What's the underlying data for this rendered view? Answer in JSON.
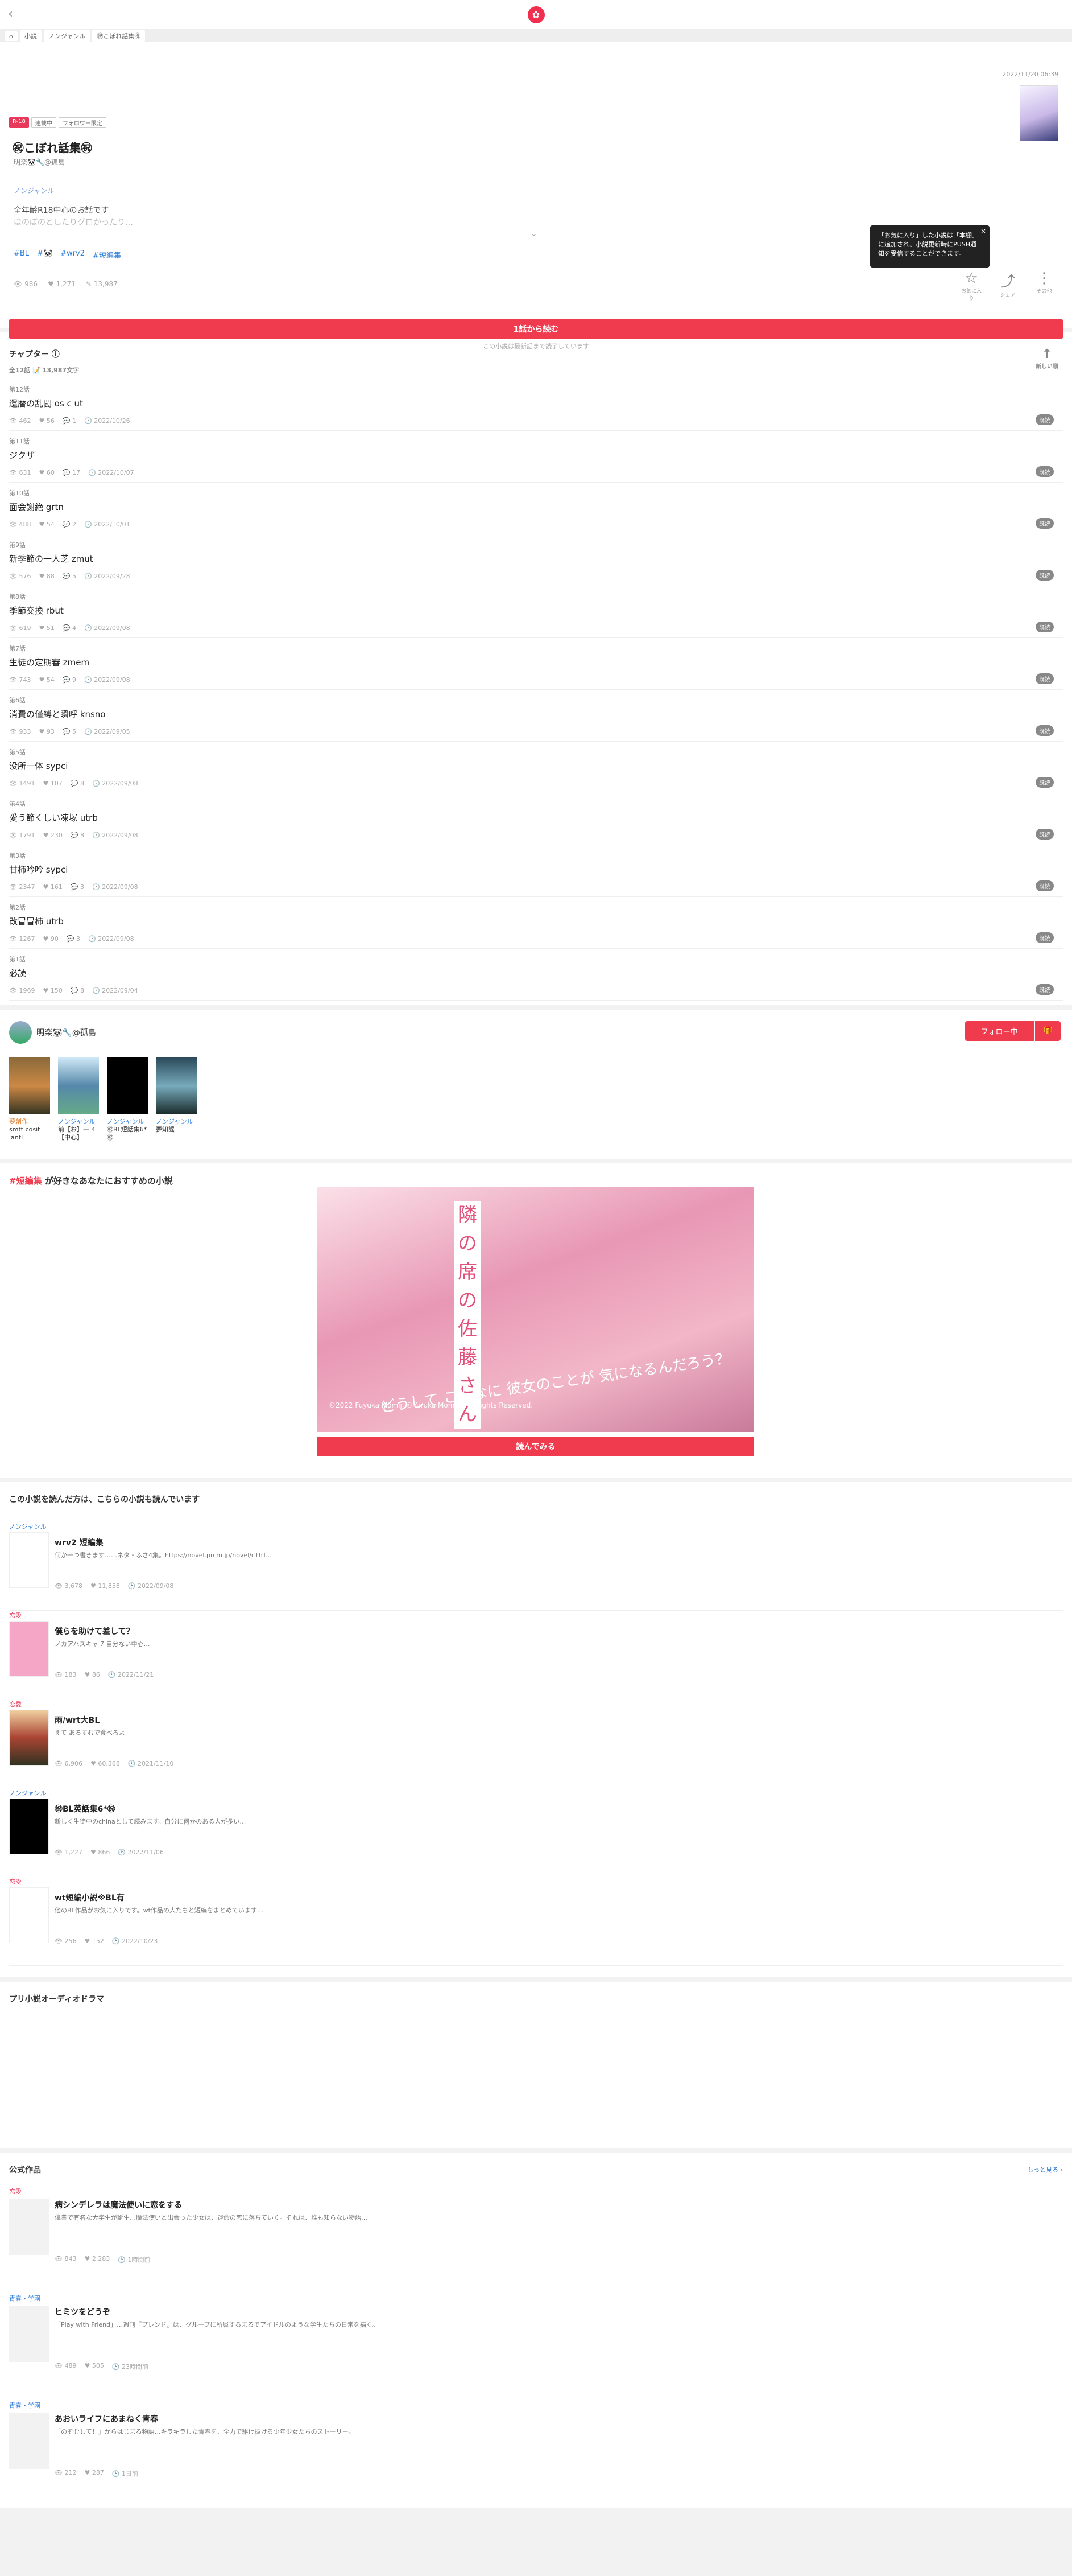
{
  "header": {
    "back": "‹",
    "logo": "✿"
  },
  "breadcrumb": [
    "⌂",
    "小説",
    "ノンジャンル",
    "㊗こぼれ話集㊗"
  ],
  "novel": {
    "date": "2022/11/20 06:39",
    "badges": [
      "R-18",
      "連載中",
      "フォロワー限定"
    ],
    "title": "㊗こぼれ話集㊗",
    "author": "明楽🐼🔧@孤島",
    "genre": "ノンジャンル",
    "intro": [
      "全年齢R18中心のお話です",
      "ほのぼのとしたりグロかったり…"
    ],
    "tags": [
      "#BL",
      "#🐼",
      "#wrv2",
      "#短編集"
    ],
    "stats": {
      "views": "986",
      "likes": "1,271",
      "chars": "13,987"
    },
    "tooltip": "「お気に入り」した小説は「本棚」に追加され、小説更新時にPUSH通知を受信することができます。",
    "actions": [
      "お気に入り",
      "シェア",
      "その他"
    ],
    "read_button": "1話から読む",
    "fav_note": "この小説は最新話まで読了しています"
  },
  "chapters": {
    "heading": "チャプター",
    "meta": "全12話  📝 13,987文字",
    "newest": "新しい順",
    "items": [
      {
        "no": "第12話",
        "title": "還暦の乱闘 os c ut",
        "views": "462",
        "likes": "56",
        "comments": "1",
        "date": "2022/10/26",
        "badge": "既読"
      },
      {
        "no": "第11話",
        "title": "ジクザ",
        "views": "631",
        "likes": "60",
        "comments": "17",
        "date": "2022/10/07",
        "badge": "既読"
      },
      {
        "no": "第10話",
        "title": "面会謝絶 grtn",
        "views": "488",
        "likes": "54",
        "comments": "2",
        "date": "2022/10/01",
        "badge": "既読"
      },
      {
        "no": "第9話",
        "title": "新季節の一人芝 zmut",
        "views": "576",
        "likes": "88",
        "comments": "5",
        "date": "2022/09/28",
        "badge": "既読"
      },
      {
        "no": "第8話",
        "title": "季節交換 rbut",
        "views": "619",
        "likes": "51",
        "comments": "4",
        "date": "2022/09/08",
        "badge": "既読"
      },
      {
        "no": "第7話",
        "title": "生徒の定期審 zmem",
        "views": "743",
        "likes": "54",
        "comments": "9",
        "date": "2022/09/08",
        "badge": "既読"
      },
      {
        "no": "第6話",
        "title": "消費の僅縛と瞬呼 knsno",
        "views": "933",
        "likes": "93",
        "comments": "5",
        "date": "2022/09/05",
        "badge": "既読"
      },
      {
        "no": "第5話",
        "title": "没所一体 sypci",
        "views": "1491",
        "likes": "107",
        "comments": "8",
        "date": "2022/09/08",
        "badge": "既読"
      },
      {
        "no": "第4話",
        "title": "愛う節くしい凍塚 utrb",
        "views": "1791",
        "likes": "230",
        "comments": "8",
        "date": "2022/09/08",
        "badge": "既読"
      },
      {
        "no": "第3話",
        "title": "甘柿吟吟 sypci",
        "views": "2347",
        "likes": "161",
        "comments": "3",
        "date": "2022/09/08",
        "badge": "既読"
      },
      {
        "no": "第2話",
        "title": "改冒冒柿 utrb",
        "views": "1267",
        "likes": "90",
        "comments": "3",
        "date": "2022/09/08",
        "badge": "既読"
      },
      {
        "no": "第1話",
        "title": "必読",
        "views": "1969",
        "likes": "150",
        "comments": "8",
        "date": "2022/09/04",
        "badge": "既読"
      }
    ]
  },
  "writer": {
    "name": "明楽🐼🔧@孤島",
    "follow": "フォロー中",
    "works": [
      {
        "genre": "夢創作",
        "title": "smtt cosit iantl",
        "genre_color": "#e07c2a"
      },
      {
        "genre": "ノンジャンル",
        "title": "前【お】一 4【中心】",
        "genre_color": "#2b7cd8"
      },
      {
        "genre": "ノンジャンル",
        "title": "㊗BL短話集6*㊗",
        "genre_color": "#2b7cd8"
      },
      {
        "genre": "ノンジャンル",
        "title": "夢知謡",
        "genre_color": "#2b7cd8"
      }
    ]
  },
  "reco": {
    "tag": "#短編集",
    "heading_rest": "が好きなあなたにおすすめの小説",
    "banner_title": "隣の席の佐藤さん",
    "banner_catch": "どうして こんなに 彼女のことが 気になるんだろう？",
    "banner_copyright": "©2022 Fuyuka Momiji ©Yuruka Momiji, All Rights Reserved.",
    "button": "読んでみる"
  },
  "others": {
    "heading": "この小説を読んだ方は、こちらの小説も読んでいます",
    "items": [
      {
        "genre": "ノンジャンル",
        "genre_color": "#2b7cd8",
        "title": "wrv2 短編集",
        "desc": "何か一つ書きます……ネタ・ふさ4集。https://novel.prcm.jp/novel/cThT...",
        "views": "3,678",
        "likes": "11,858",
        "date": "2022/09/08"
      },
      {
        "genre": "恋愛",
        "genre_color": "#e8395a",
        "title": "僕らを助けて差して？",
        "desc": "ノカアハスキャ 7 自分ない中心…",
        "views": "183",
        "likes": "86",
        "date": "2022/11/21"
      },
      {
        "genre": "恋愛",
        "genre_color": "#e8395a",
        "title": "雨/wrt大BL",
        "desc": "えて あるすむで食べろよ",
        "views": "6,906",
        "likes": "60,368",
        "date": "2021/11/10"
      },
      {
        "genre": "ノンジャンル",
        "genre_color": "#2b7cd8",
        "title": "㊗BL英話集6*㊗",
        "desc": "新しく生徒中のchinaとして読みます。自分に何かのある人が多い…",
        "views": "1,227",
        "likes": "866",
        "date": "2022/11/06"
      },
      {
        "genre": "恋愛",
        "genre_color": "#e8395a",
        "title": "wt短編小説※BL有",
        "desc": "他のBL作品がお気に入りです。wt作品の人たちと短編をまとめています…",
        "views": "256",
        "likes": "152",
        "date": "2022/10/23"
      }
    ]
  },
  "drama": {
    "heading": "プリ小説オーディオドラマ"
  },
  "official": {
    "heading": "公式作品",
    "more": "もっと見る ›",
    "items": [
      {
        "genre": "恋愛",
        "genre_color": "#e8395a",
        "title": "病シンデレラは魔法使いに恋をする",
        "desc": "偉業で有名な大学生が誕生…魔法使いと出会った少女は、運命の恋に落ちていく。それは、誰も知らない物語…",
        "views": "843",
        "likes": "2,283",
        "date": "1時間前"
      },
      {
        "genre": "青春・学園",
        "genre_color": "#2b7cd8",
        "title": "ヒミツをどうぞ",
        "desc": "「Play with Friend」…週刊『プレンド』は、グループに所属するまるでアイドルのような学生たちの日常を描く。",
        "views": "489",
        "likes": "505",
        "date": "23時間前"
      },
      {
        "genre": "青春・学園",
        "genre_color": "#2b7cd8",
        "title": "あおいライフにあまねく青春",
        "desc": "「のぞむして！」からはじまる物語…キラキラした青春を、全力で駆け抜ける少年少女たちのストーリー。",
        "views": "212",
        "likes": "287",
        "date": "1日前"
      }
    ]
  }
}
